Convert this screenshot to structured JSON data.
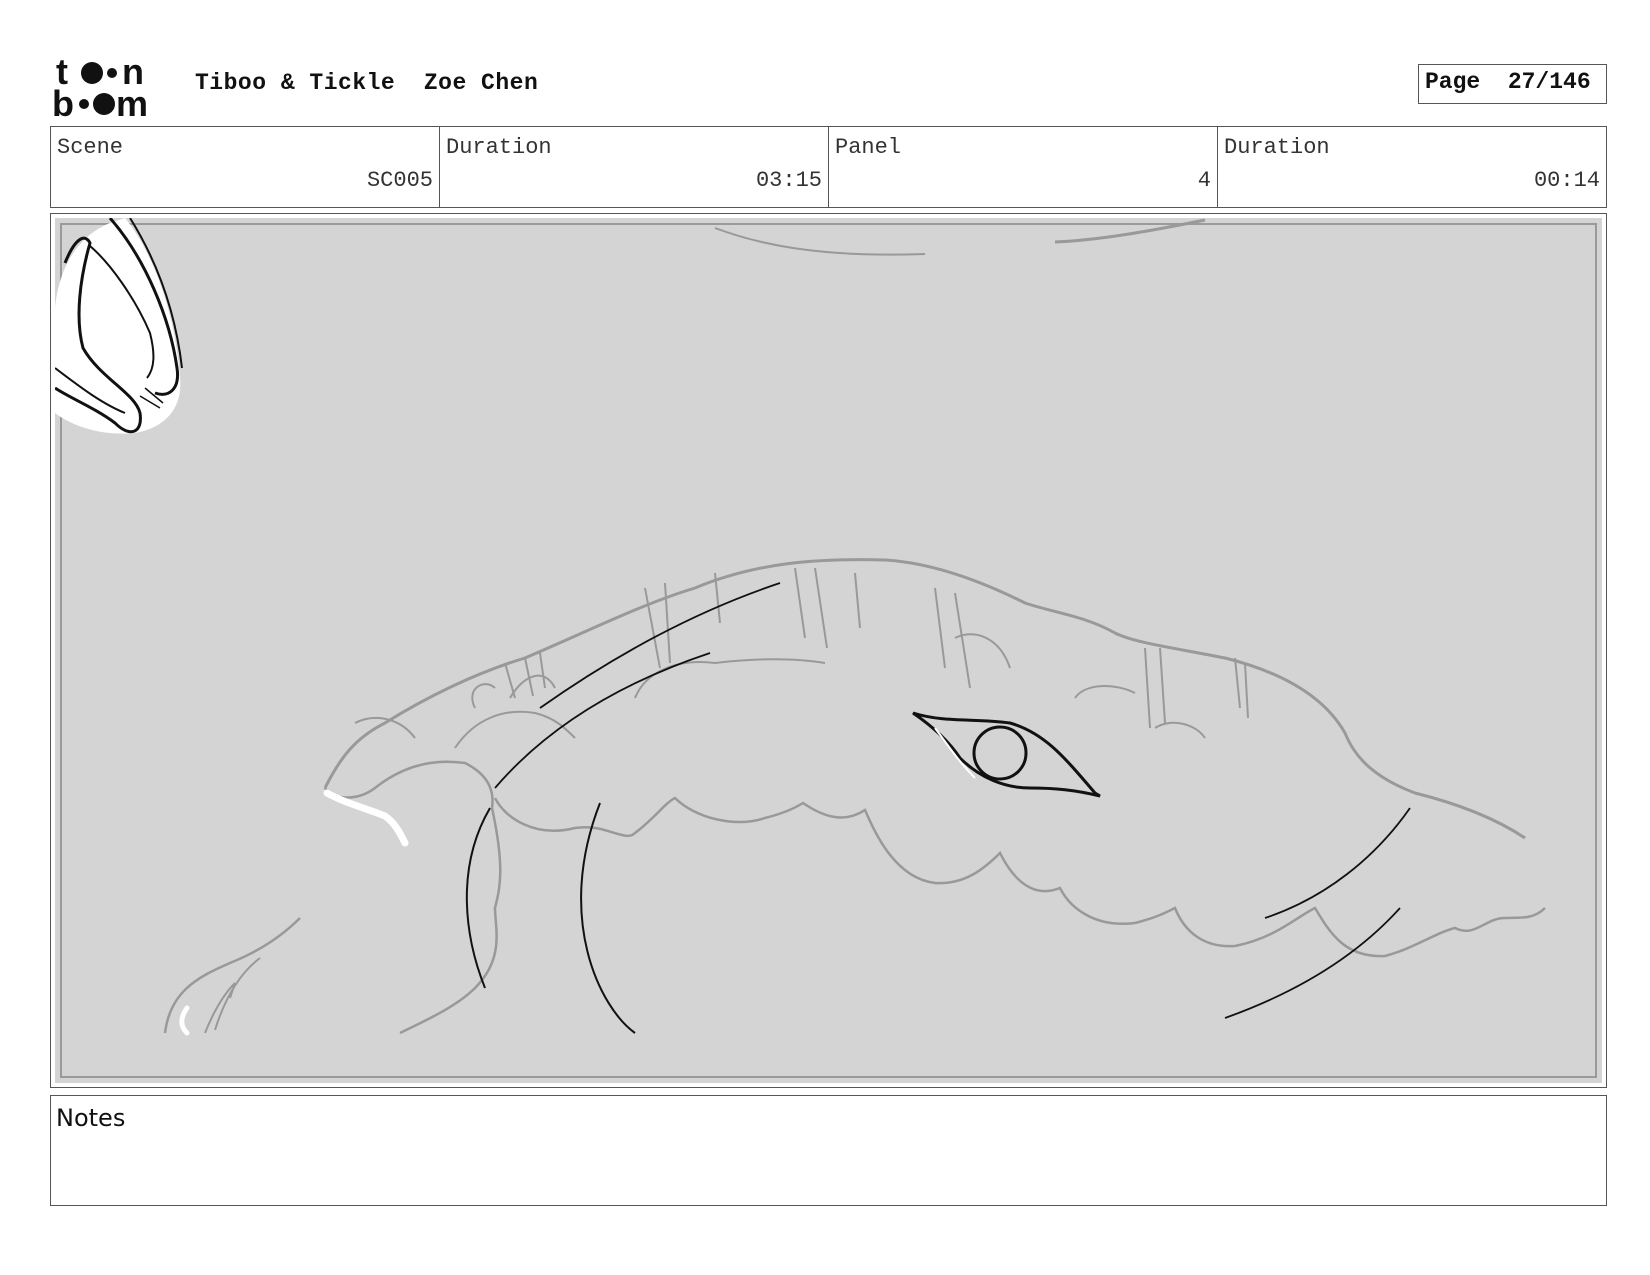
{
  "header": {
    "logo_text_top": "t  n",
    "logo_text_bottom": "b  m",
    "project_title": "Tiboo & Tickle",
    "author": "Zoe Chen",
    "page_label": "Page",
    "page_number": "27/146"
  },
  "info": {
    "scene_label": "Scene",
    "scene_value": "SC005",
    "scene_duration_label": "Duration",
    "scene_duration_value": "03:15",
    "panel_label": "Panel",
    "panel_value": "4",
    "panel_duration_label": "Duration",
    "panel_duration_value": "00:14"
  },
  "notes": {
    "label": "Notes",
    "text": ""
  },
  "colors": {
    "panel_background": "#d4d4d4",
    "sketch_gray": "#999999",
    "ink_black": "#111111",
    "border": "#555555"
  }
}
